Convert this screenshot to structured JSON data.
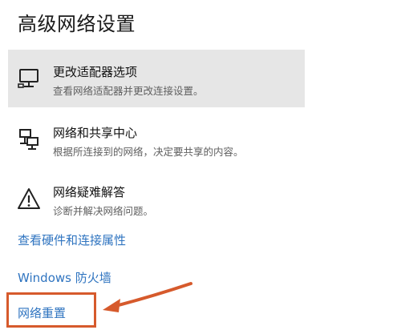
{
  "page": {
    "title": "高级网络设置"
  },
  "options": [
    {
      "title": "更改适配器选项",
      "description": "查看网络适配器并更改连接设置。",
      "icon": "monitor-icon"
    },
    {
      "title": "网络和共享中心",
      "description": "根据所连接到的网络，决定要共享的内容。",
      "icon": "network-share-icon"
    },
    {
      "title": "网络疑难解答",
      "description": "诊断并解决网络问题。",
      "icon": "warning-icon"
    }
  ],
  "links": {
    "hardware_properties": "查看硬件和连接属性",
    "firewall": "Windows 防火墙",
    "network_reset": "网络重置"
  },
  "colors": {
    "link": "#2f74c0",
    "highlight_bg": "#e6e6e6",
    "annotation": "#d65a2c"
  }
}
